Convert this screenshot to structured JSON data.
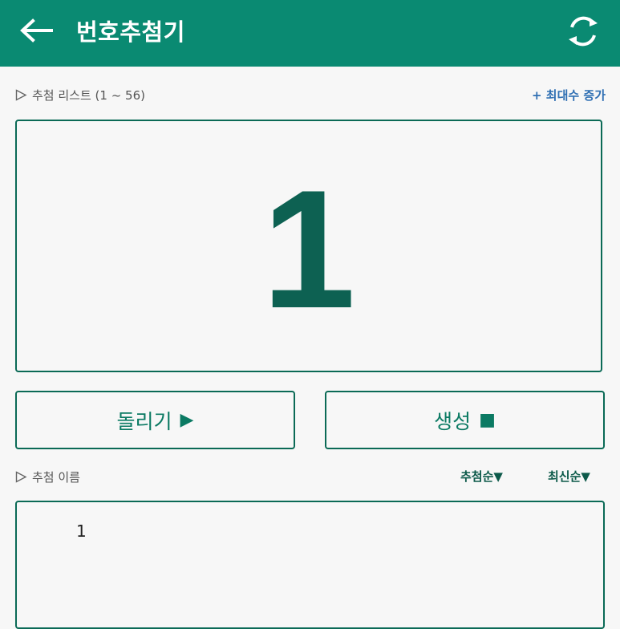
{
  "app": {
    "title": "번호추첨기",
    "back_icon": "arrow-left-icon",
    "refresh_icon": "refresh-icon",
    "accent_color": "#0a8a72"
  },
  "draw_list": {
    "label": "추첨 리스트 (1 ~ 56)",
    "add_max_label": "+ 최대수 증가",
    "current_number": "1"
  },
  "actions": {
    "spin_label": "돌리기",
    "spin_glyph": "▶",
    "generate_label": "생성",
    "generate_glyph": "■"
  },
  "names": {
    "label": "추첨 이름",
    "sort_draw_order": "추첨순▼",
    "sort_latest": "최신순▼",
    "entries": [
      "1"
    ]
  }
}
